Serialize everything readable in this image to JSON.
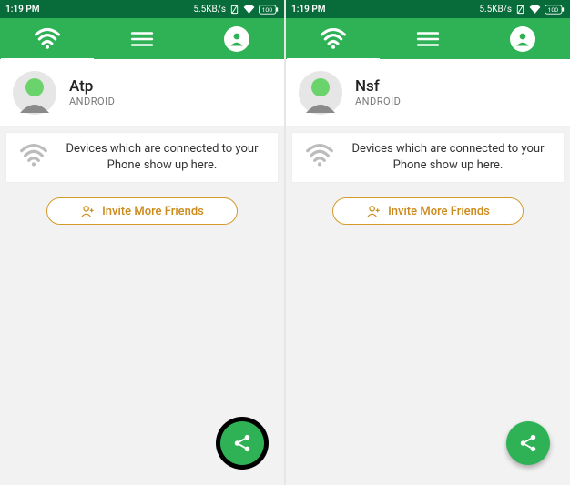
{
  "screens": [
    {
      "statusbar": {
        "time": "1:19 PM",
        "speed": "5.5KB/s",
        "battery": "100"
      },
      "user": {
        "name": "Atp",
        "sub": "ANDROID"
      },
      "devices_msg": "Devices which are connected to your Phone show up here.",
      "invite_label": "Invite More Friends",
      "fab_highlight": true
    },
    {
      "statusbar": {
        "time": "1:19 PM",
        "speed": "5.5KB/s",
        "battery": "100"
      },
      "user": {
        "name": "Nsf",
        "sub": "ANDROID"
      },
      "devices_msg": "Devices which are connected to your Phone show up here.",
      "invite_label": "Invite More Friends",
      "fab_highlight": false
    }
  ],
  "colors": {
    "brand_green": "#2fb255",
    "brand_dark": "#076b3a",
    "orange": "#cc8a1c"
  }
}
